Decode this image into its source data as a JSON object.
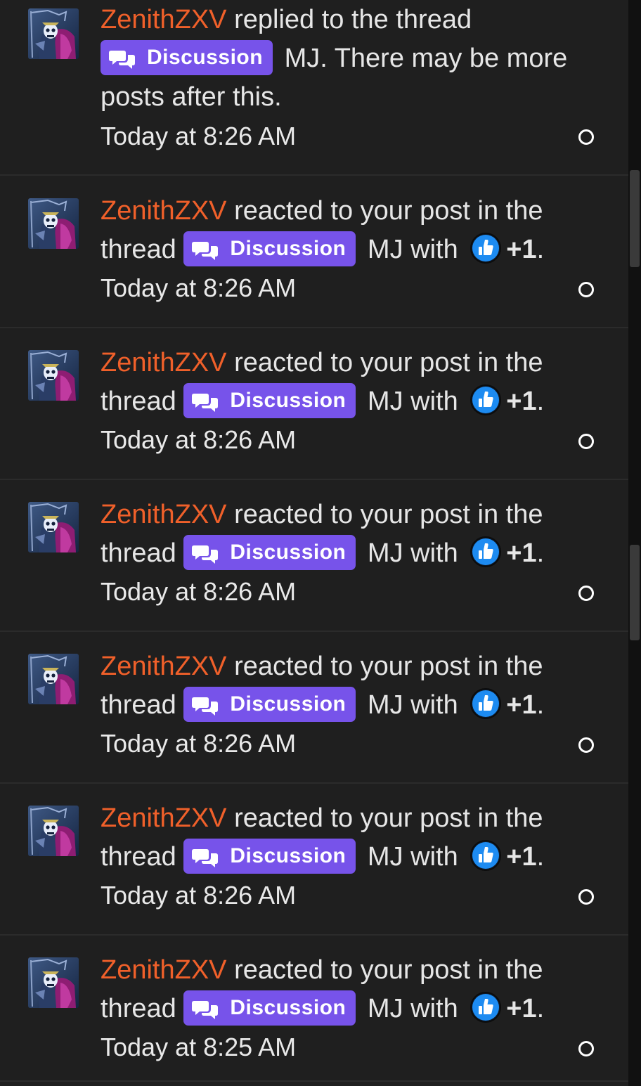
{
  "alerts": [
    {
      "user": "ZenithZXV",
      "lead": " replied to the thread ",
      "prefix_label": "Discussion",
      "title": " MJ. There may be more posts after this.",
      "reaction_text": "",
      "reaction_value": "",
      "reaction_end": "",
      "time": "Today at 8:26 AM"
    },
    {
      "user": "ZenithZXV",
      "lead": " reacted to your post in the thread ",
      "prefix_label": "Discussion",
      "title": " MJ with ",
      "reaction_icon": "thumbs-up-icon",
      "reaction_value": "+1",
      "reaction_end": ".",
      "time": "Today at 8:26 AM"
    },
    {
      "user": "ZenithZXV",
      "lead": " reacted to your post in the thread ",
      "prefix_label": "Discussion",
      "title": " MJ with ",
      "reaction_icon": "thumbs-up-icon",
      "reaction_value": "+1",
      "reaction_end": ".",
      "time": "Today at 8:26 AM"
    },
    {
      "user": "ZenithZXV",
      "lead": " reacted to your post in the thread ",
      "prefix_label": "Discussion",
      "title": " MJ with ",
      "reaction_icon": "thumbs-up-icon",
      "reaction_value": "+1",
      "reaction_end": ".",
      "time": "Today at 8:26 AM"
    },
    {
      "user": "ZenithZXV",
      "lead": " reacted to your post in the thread ",
      "prefix_label": "Discussion",
      "title": " MJ with ",
      "reaction_icon": "thumbs-up-icon",
      "reaction_value": "+1",
      "reaction_end": ".",
      "time": "Today at 8:26 AM"
    },
    {
      "user": "ZenithZXV",
      "lead": " reacted to your post in the thread ",
      "prefix_label": "Discussion",
      "title": " MJ with ",
      "reaction_icon": "thumbs-up-icon",
      "reaction_value": "+1",
      "reaction_end": ".",
      "time": "Today at 8:26 AM"
    },
    {
      "user": "ZenithZXV",
      "lead": " reacted to your post in the thread ",
      "prefix_label": "Discussion",
      "title": " MJ with ",
      "reaction_icon": "thumbs-up-icon",
      "reaction_value": "+1",
      "reaction_end": ".",
      "time": "Today at 8:25 AM"
    }
  ],
  "colors": {
    "background": "#1f1f1f",
    "username": "#f0602a",
    "prefix_badge": "#7753ea",
    "reaction_icon": "#1d8bf1"
  },
  "icons": {
    "prefix": "chat-bubbles-icon",
    "avatar": "skull-avatar-image",
    "mark_read": "circle-outline-icon"
  }
}
